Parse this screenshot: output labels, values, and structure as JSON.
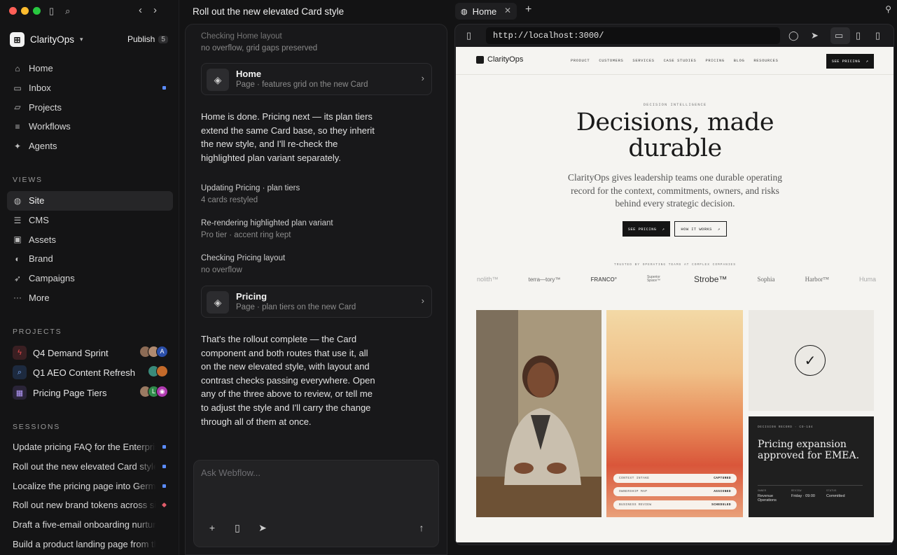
{
  "window": {
    "chat_title": "Roll out the new elevated Card style"
  },
  "sidebar": {
    "workspace": "ClarityOps",
    "publish_label": "Publish",
    "publish_count": "5",
    "nav": [
      {
        "label": "Home",
        "icon": "home-icon"
      },
      {
        "label": "Inbox",
        "icon": "inbox-icon"
      },
      {
        "label": "Projects",
        "icon": "folder-icon"
      },
      {
        "label": "Workflows",
        "icon": "workflow-icon"
      },
      {
        "label": "Agents",
        "icon": "sparkle-icon"
      }
    ],
    "views_heading": "VIEWS",
    "views": [
      {
        "label": "Site",
        "icon": "globe-icon"
      },
      {
        "label": "CMS",
        "icon": "database-icon"
      },
      {
        "label": "Assets",
        "icon": "image-icon"
      },
      {
        "label": "Brand",
        "icon": "palette-icon"
      },
      {
        "label": "Campaigns",
        "icon": "rocket-icon"
      },
      {
        "label": "More",
        "icon": "more-icon"
      }
    ],
    "projects_heading": "PROJECTS",
    "projects": [
      {
        "label": "Q4 Demand Sprint",
        "icon": "bolt-icon",
        "color": "#e2484b"
      },
      {
        "label": "Q1 AEO Content Refresh",
        "icon": "search-icon",
        "color": "#4a8cff"
      },
      {
        "label": "Pricing Page Tiers",
        "icon": "table-icon",
        "color": "#9b7cf0"
      }
    ],
    "sessions_heading": "SESSIONS",
    "sessions": [
      {
        "label": "Update pricing FAQ for the Enterprise",
        "color": "#5b8cff"
      },
      {
        "label": "Roll out the new elevated Card style",
        "color": "#5b8cff"
      },
      {
        "label": "Localize the pricing page into German",
        "color": "#5b8cff"
      },
      {
        "label": "Roll out new brand tokens across site",
        "color": "#e05c6a"
      },
      {
        "label": "Draft a five-email onboarding nurture",
        "color": ""
      },
      {
        "label": "Build a product landing page from the",
        "color": ""
      }
    ]
  },
  "chat": {
    "top_step": "Checking Home layout",
    "top_step_detail": "no overflow, grid gaps preserved",
    "card_home": {
      "title": "Home",
      "subtitle": "Page · features grid on the new Card"
    },
    "para1": "Home is done. Pricing next — its plan tiers extend the same Card base, so they inherit the new style, and I'll re-check the highlighted plan variant separately.",
    "steps": [
      {
        "label": "Updating Pricing · plan tiers",
        "detail": "4 cards restyled"
      },
      {
        "label": "Re-rendering highlighted plan variant",
        "detail": "Pro tier · accent ring kept"
      },
      {
        "label": "Checking Pricing layout",
        "detail": "no overflow"
      }
    ],
    "card_pricing": {
      "title": "Pricing",
      "subtitle": "Page · plan tiers on the new Card"
    },
    "para2": "That's the rollout complete — the Card component and both routes that use it, all on the new elevated style, with layout and contrast checks passing everywhere. Open any of the three above to review, or tell me to adjust the style and I'll carry the change through all of them at once.",
    "composer_placeholder": "Ask Webflow..."
  },
  "browser": {
    "tab_label": "Home",
    "url": "http://localhost:3000/"
  },
  "site": {
    "brand": "ClarityOps",
    "nav_links": [
      "PRODUCT",
      "CUSTOMERS",
      "SERVICES",
      "CASE STUDIES",
      "PRICING",
      "BLOG",
      "RESOURCES"
    ],
    "nav_cta": "SEE PRICING",
    "eyebrow": "DECISION INTELLIGENCE",
    "hero_line1": "Decisions, made",
    "hero_line2": "durable",
    "subtitle": "ClarityOps gives leadership teams one durable operating record for the context, commitments, owners, and risks behind every strategic decision.",
    "btn_primary": "SEE PRICING",
    "btn_secondary": "HOW IT WORKS",
    "trusted": "TRUSTED BY OPERATING TEAMS AT COMPLEX COMPANIES",
    "logos": [
      "nolith™",
      "terra—tory™",
      "FRANCO°",
      "Superior Space™",
      "Strobe™",
      "Sophia",
      "Harbor™",
      "Huma"
    ],
    "pills": [
      {
        "label": "CONTEXT INTAKE",
        "status": "CAPTURED"
      },
      {
        "label": "OWNERSHIP MAP",
        "status": "ASSIGNED"
      },
      {
        "label": "BUSINESS REVIEW",
        "status": "SCHEDULED"
      }
    ],
    "record": {
      "label": "DECISION RECORD · CO-184",
      "title": "Pricing expansion approved for EMEA.",
      "meta": [
        {
          "k": "OWNER",
          "v": "Revenue Operations"
        },
        {
          "k": "REVIEW",
          "v": "Friday · 09:00"
        },
        {
          "k": "STATUS",
          "v": "Committed"
        }
      ]
    }
  }
}
